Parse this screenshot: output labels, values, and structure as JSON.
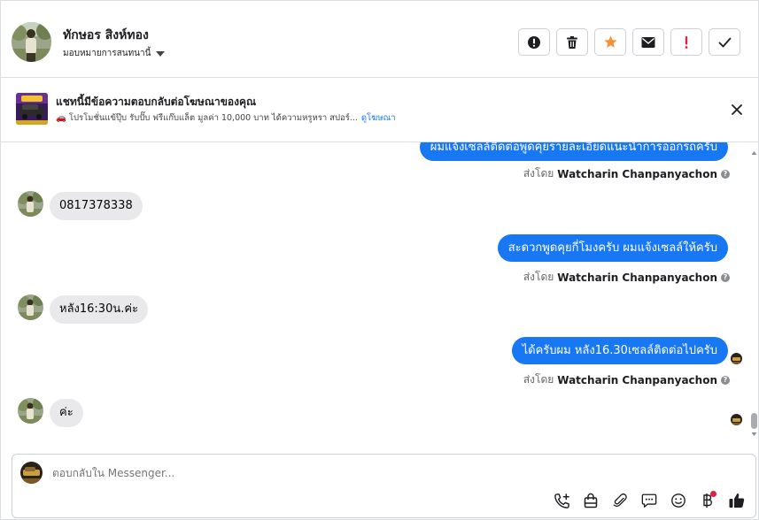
{
  "header": {
    "contact_name": "ทักษอร สิงห์ทอง",
    "assign_label": "มอบหมายการสนทนานี้",
    "actions": [
      {
        "name": "spam-button",
        "icon": "exclamation-circle-icon"
      },
      {
        "name": "delete-button",
        "icon": "trash-icon"
      },
      {
        "name": "star-button",
        "icon": "star-icon"
      },
      {
        "name": "mark-unread-button",
        "icon": "envelope-icon"
      },
      {
        "name": "follow-up-button",
        "icon": "exclamation-icon"
      },
      {
        "name": "mark-done-button",
        "icon": "checkmark-icon"
      }
    ]
  },
  "banner": {
    "title": "แชทนี้มีข้อความตอบกลับต่อโฆษณาของคุณ",
    "subtitle": "🚗 โปรโมชั่นแข้ปุ๊บ รับปั๊บ ฟรีแก๊บแล็ต มูลค่า 10,000 บาท ได้ความหรูหรา สปอร์...",
    "link": "ดูโฆษณา"
  },
  "messages": {
    "out1": "ผมแจ้งเซลล์ติดต่อพูดคุยรายละเอียดแนะนำการออกรถครับ",
    "sent_prefix": "ส่งโดย",
    "agent": "Watcharin Chanpanyachon",
    "in1": "0817378338",
    "out2": "สะดวกพูดคุยกี่โมงครับ ผมแจ้งเซลล์ให้ครับ",
    "in2": "หลัง16:30น.ค่ะ",
    "out3": "ได้ครับผม หลัง16.30เซลล์ติดต่อไปครับ",
    "in3": "ค่ะ"
  },
  "composer": {
    "placeholder": "ตอบกลับใน Messenger...",
    "tools": [
      "call-add-icon",
      "shopping-bag-icon",
      "paperclip-icon",
      "chat-bubble-icon",
      "smiley-icon",
      "baht-icon",
      "thumbs-up-icon"
    ]
  },
  "colors": {
    "accent": "#1877f2",
    "incoming_bubble": "#e9e9eb",
    "star": "#f7923b",
    "flag": "#e41e3f"
  }
}
